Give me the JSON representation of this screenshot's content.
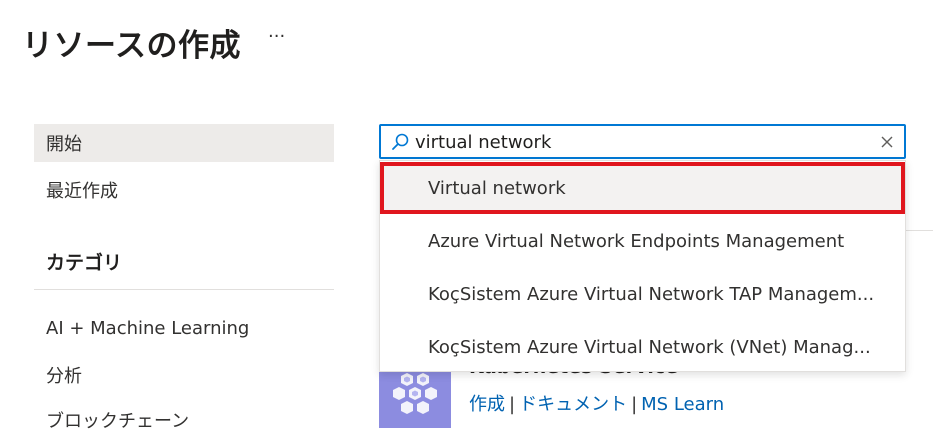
{
  "header": {
    "title": "リソースの作成",
    "more_label": "···"
  },
  "sidebar": {
    "items": [
      {
        "label": "開始",
        "selected": true
      },
      {
        "label": "最近作成",
        "selected": false
      }
    ],
    "category_heading": "カテゴリ",
    "categories": [
      {
        "label": "AI + Machine Learning"
      },
      {
        "label": "分析"
      },
      {
        "label": "ブロックチェーン"
      }
    ]
  },
  "search": {
    "value": "virtual network",
    "icon": "search-icon",
    "clear_icon": "close-icon"
  },
  "dropdown": {
    "options": [
      {
        "label": "Virtual network",
        "highlighted": true
      },
      {
        "label": "Azure Virtual Network Endpoints Management"
      },
      {
        "label": "KoçSistem Azure Virtual Network TAP Managem..."
      },
      {
        "label": "KoçSistem Azure Virtual Network (VNet) Manag..."
      }
    ],
    "highlight_color": "#e0161e"
  },
  "service_card": {
    "title": "Kubernetes Service",
    "links": {
      "create": "作成",
      "docs": "ドキュメント",
      "learn": "MS Learn"
    },
    "separator": "|"
  },
  "colors": {
    "accent": "#0078d4",
    "link": "#0062b1",
    "selected_bg": "#edebe9"
  }
}
